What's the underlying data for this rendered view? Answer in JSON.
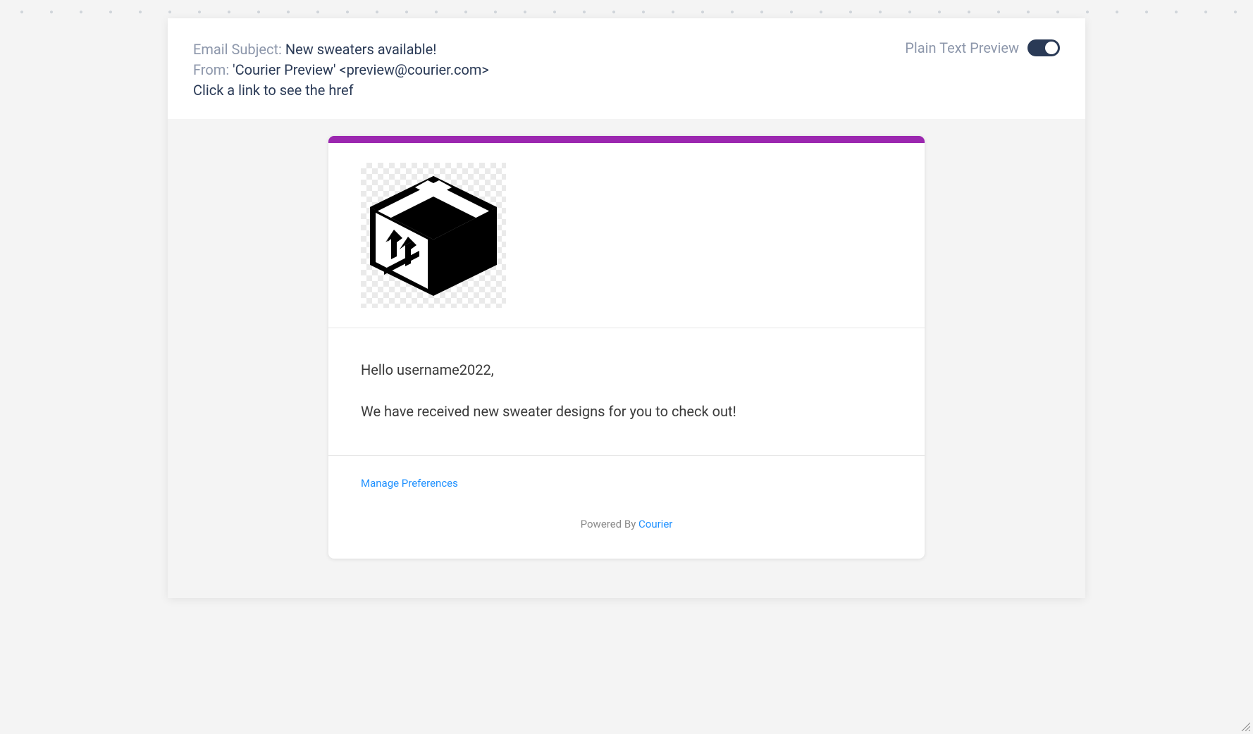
{
  "header": {
    "labels": {
      "subject": "Email Subject:",
      "from": "From:"
    },
    "subject": "New sweaters available!",
    "from": "'Courier Preview' <preview@courier.com>",
    "hint": "Click a link to see the href",
    "plain_text_label": "Plain Text Preview",
    "plain_text_on": true
  },
  "email": {
    "accent_color": "#9b27af",
    "logo_name": "box-icon",
    "greeting": "Hello username2022,",
    "body": "We have received new sweater designs for you to check out!",
    "preferences_link": "Manage Preferences",
    "powered_prefix": "Powered By ",
    "powered_link": "Courier"
  }
}
